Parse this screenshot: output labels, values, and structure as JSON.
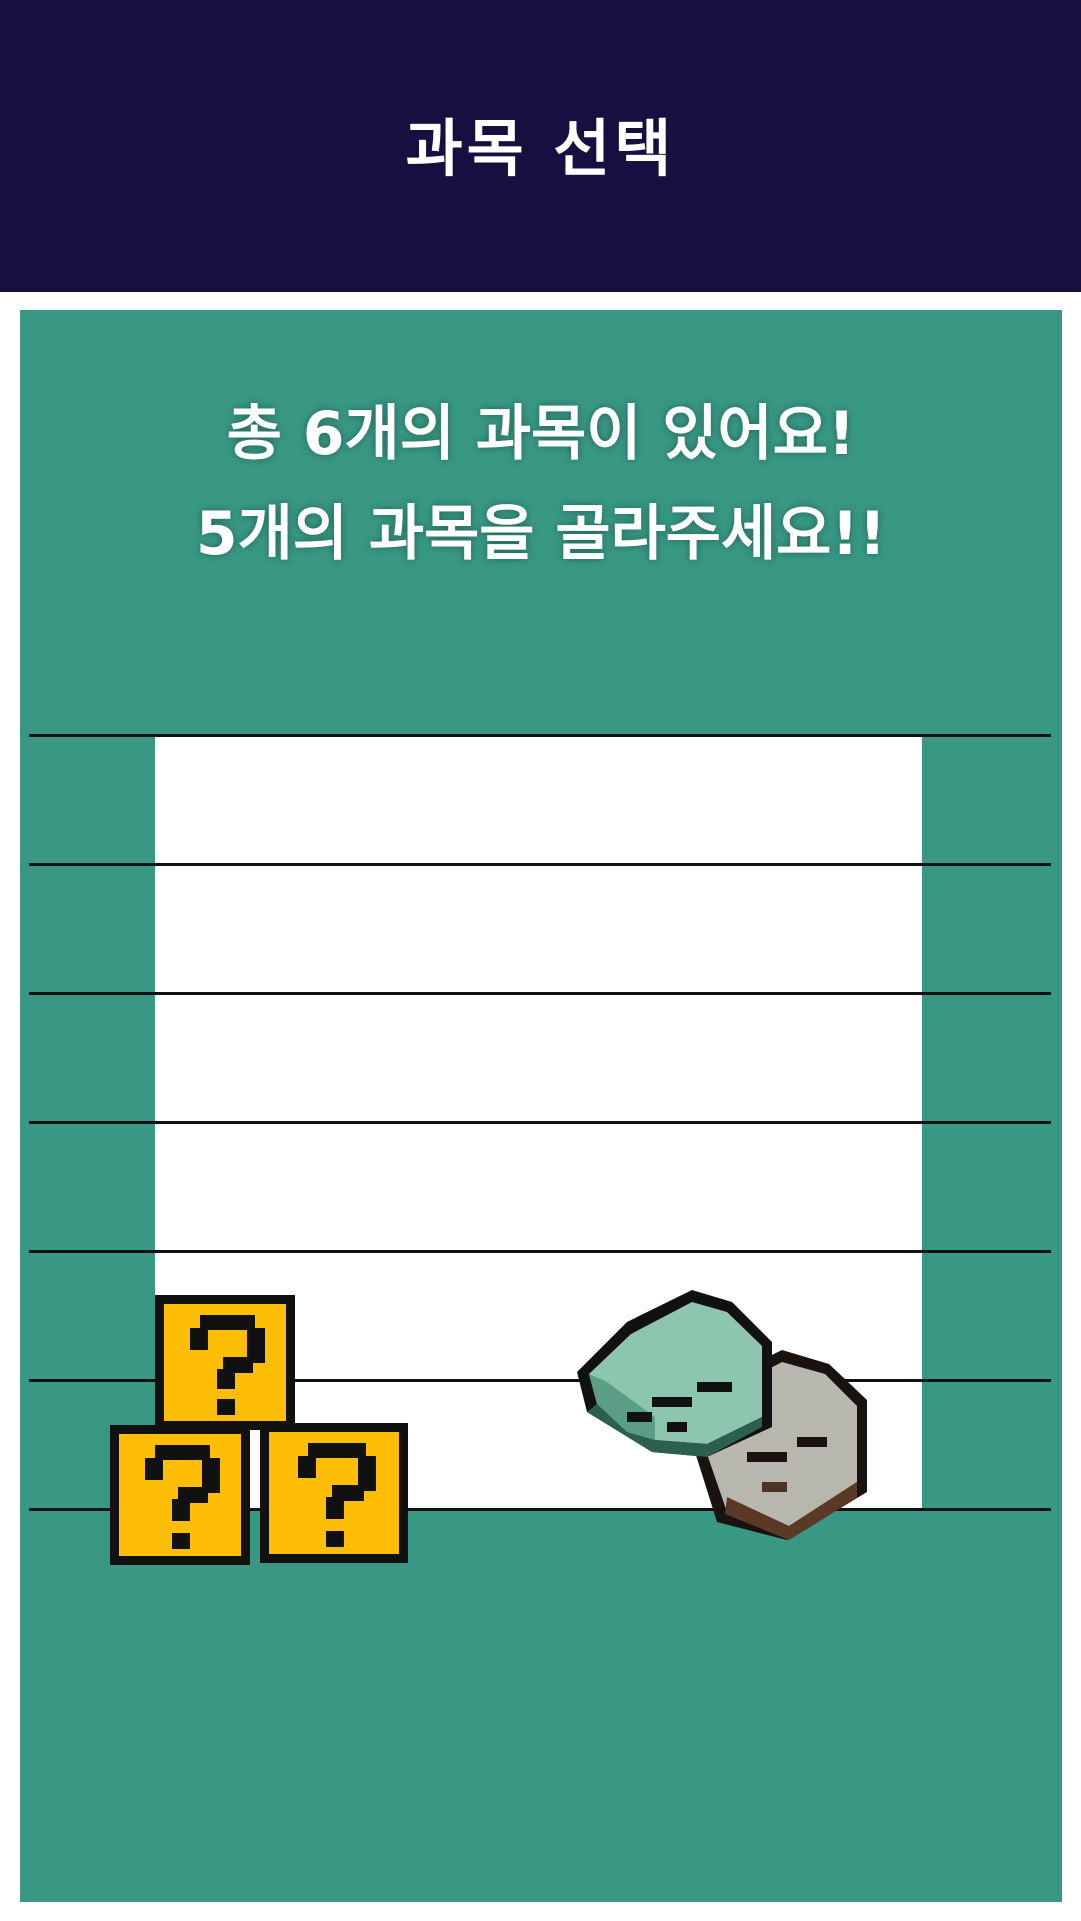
{
  "header": {
    "title": "과목 선택"
  },
  "intro": {
    "line1": "총 6개의 과목이 있어요!",
    "line2": "5개의 과목을 골라주세요!!"
  },
  "subject_slots": [
    "",
    "",
    "",
    "",
    "",
    ""
  ],
  "colors": {
    "header_bg": "#161040",
    "panel_bg": "#389884",
    "slot_bg": "#ffffff",
    "block_yellow": "#FFBE06"
  },
  "decorations": [
    "question-block-icon",
    "books-icon"
  ]
}
